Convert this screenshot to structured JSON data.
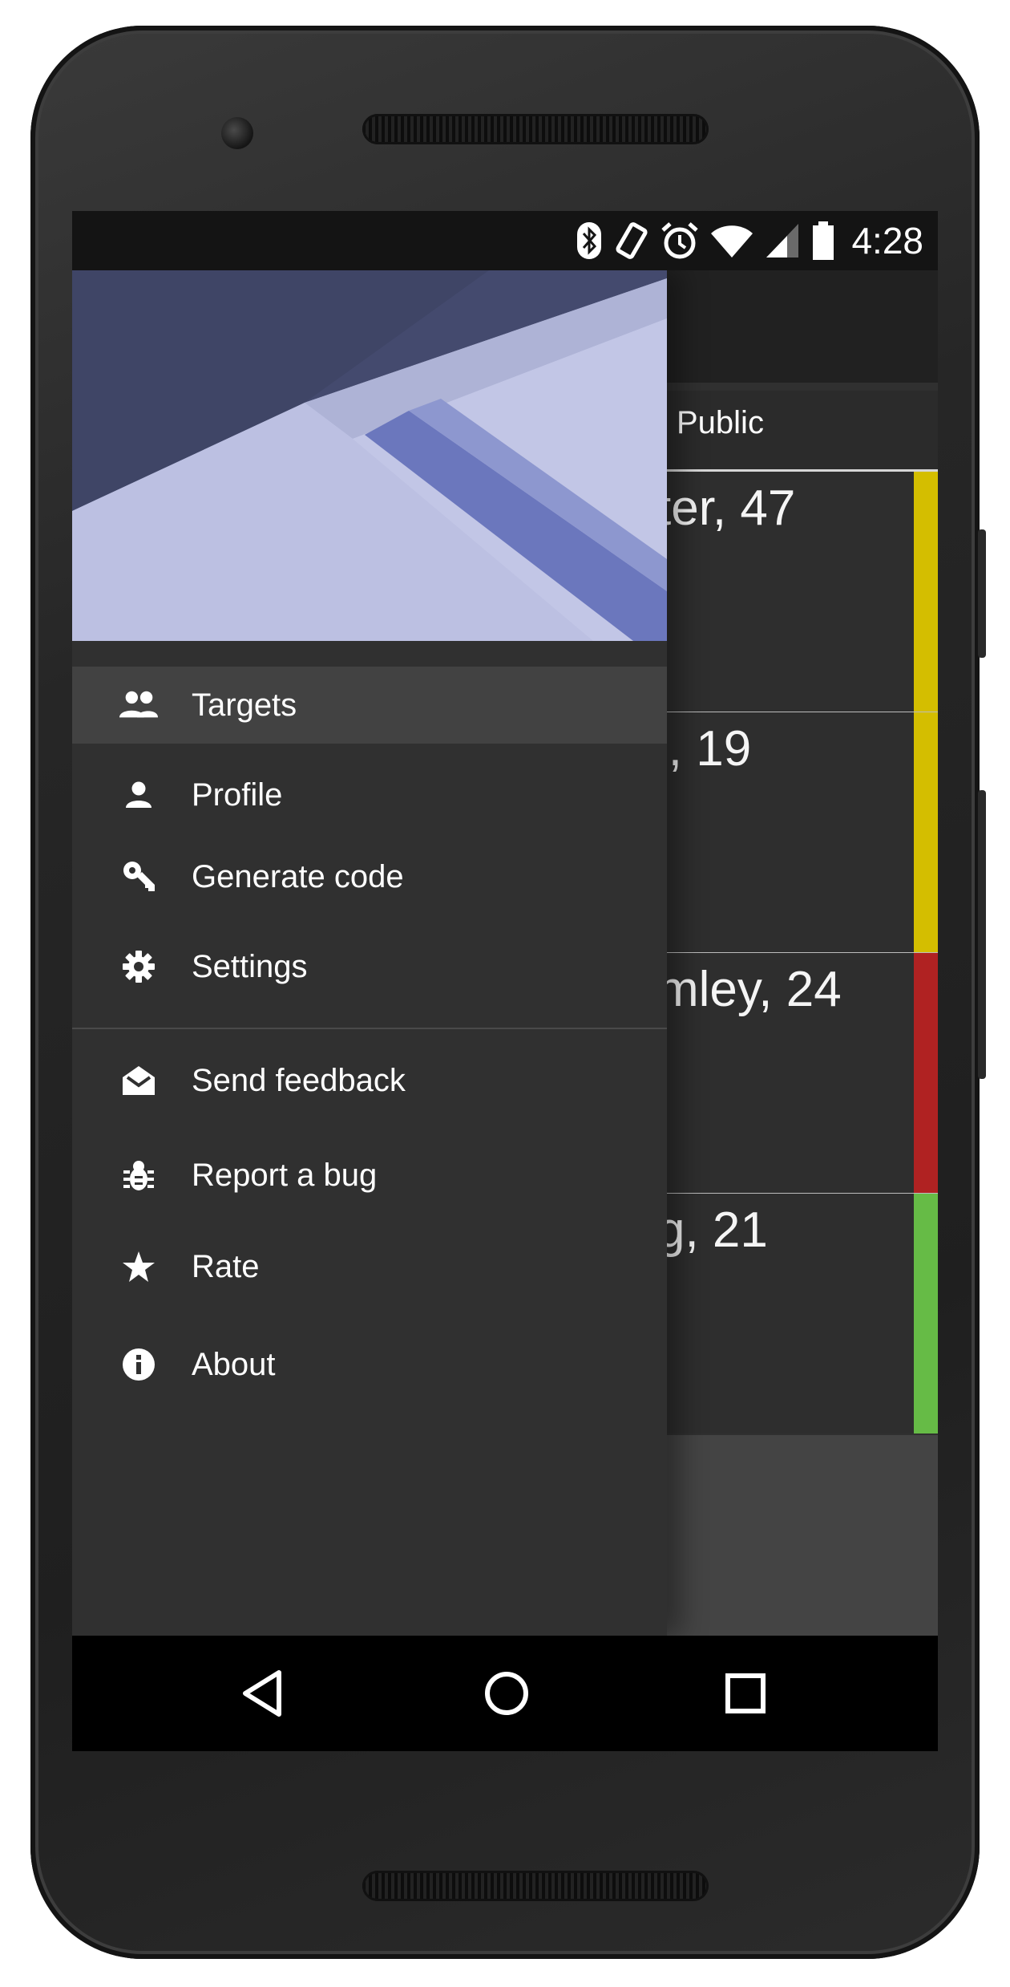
{
  "status_bar": {
    "time": "4:28",
    "icons": [
      "bluetooth-icon",
      "vibrate-icon",
      "alarm-icon",
      "wifi-icon",
      "signal-icon",
      "battery-icon"
    ]
  },
  "app": {
    "tab_label": "Public",
    "targets": [
      {
        "name_fragment": "ter, 47",
        "status_color": "#d4be00"
      },
      {
        "name_fragment": "l, 19",
        "status_color": "#d4be00"
      },
      {
        "name_fragment": "mley, 24",
        "status_color": "#b02222"
      },
      {
        "name_fragment": "g, 21",
        "status_color": "#66bb46"
      }
    ]
  },
  "drawer": {
    "primary_items": [
      {
        "label": "Targets",
        "icon": "people-icon",
        "active": true
      },
      {
        "label": "Profile",
        "icon": "person-icon",
        "active": false
      },
      {
        "label": "Generate code",
        "icon": "key-icon",
        "active": false
      },
      {
        "label": "Settings",
        "icon": "gear-icon",
        "active": false
      }
    ],
    "secondary_items": [
      {
        "label": "Send feedback",
        "icon": "feedback-mail-icon"
      },
      {
        "label": "Report a bug",
        "icon": "bug-icon"
      },
      {
        "label": "Rate",
        "icon": "star-icon"
      },
      {
        "label": "About",
        "icon": "info-icon"
      }
    ]
  },
  "nav_bar": {
    "buttons": [
      "back-icon",
      "home-icon",
      "recents-icon"
    ]
  },
  "colors": {
    "drawer_bg": "#303030",
    "active_item_bg": "#424242",
    "header_accent": "#6f7bc2"
  }
}
